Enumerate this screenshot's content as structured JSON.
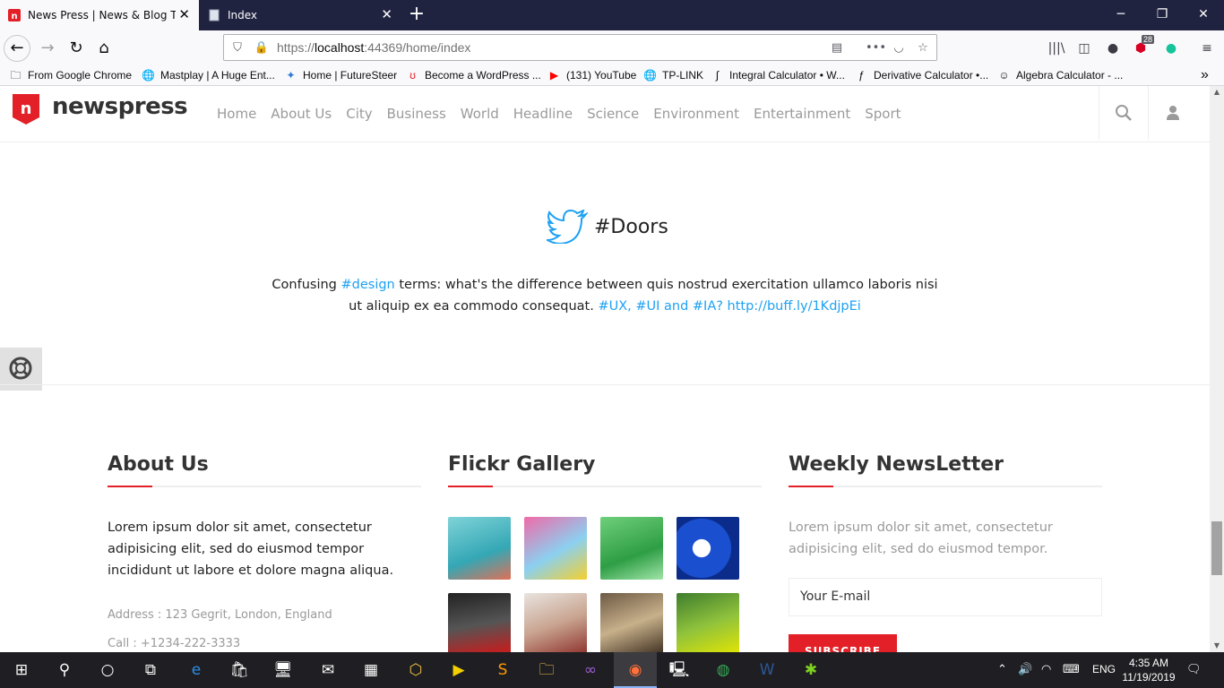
{
  "browser": {
    "tabs": [
      {
        "title": "News Press | News & Blog Temp",
        "active": true
      },
      {
        "title": "Index",
        "active": false
      }
    ],
    "url_prefix": "https://",
    "url_host": "localhost",
    "url_rest": ":44369/home/index",
    "badge_count": "28",
    "bookmarks": [
      "From Google Chrome",
      "Mastplay | A Huge Ent...",
      "Home | FutureSteer",
      "Become a WordPress ...",
      "(131) YouTube",
      "TP-LINK",
      "Integral Calculator • W...",
      "Derivative Calculator •...",
      "Algebra Calculator - ..."
    ]
  },
  "site": {
    "logo": "newspress",
    "accent_color": "#e32027",
    "menu": [
      "Home",
      "About Us",
      "City",
      "Business",
      "World",
      "Headline",
      "Science",
      "Environment",
      "Entertainment",
      "Sport"
    ]
  },
  "tweet": {
    "title": "#Doors",
    "text_1": "Confusing ",
    "tag_1": "#design",
    "text_2": " terms: what's the difference between quis nostrud exercitation ullamco laboris nisi ut aliquip ex ea commodo consequat. ",
    "tags_2": "#UX, #UI and #IA?",
    "link": "http://buff.ly/1KdjpEi",
    "link_color": "#1da1f2"
  },
  "footer": {
    "about": {
      "title": "About Us",
      "text": "Lorem ipsum dolor sit amet, consectetur adipisicing elit, sed do eiusmod tempor incididunt ut labore et dolore magna aliqua.",
      "address": "Address : 123 Gegrit, London, England",
      "call": "Call : +1234-222-3333"
    },
    "flickr": {
      "title": "Flickr Gallery"
    },
    "newsletter": {
      "title": "Weekly NewsLetter",
      "text": "Lorem ipsum dolor sit amet, consectetur adipisicing elit, sed do eiusmod tempor.",
      "placeholder": "Your E-mail",
      "button": "SUBSCRIBE"
    }
  },
  "taskbar": {
    "language": "ENG",
    "time": "4:35 AM",
    "date": "11/19/2019"
  }
}
